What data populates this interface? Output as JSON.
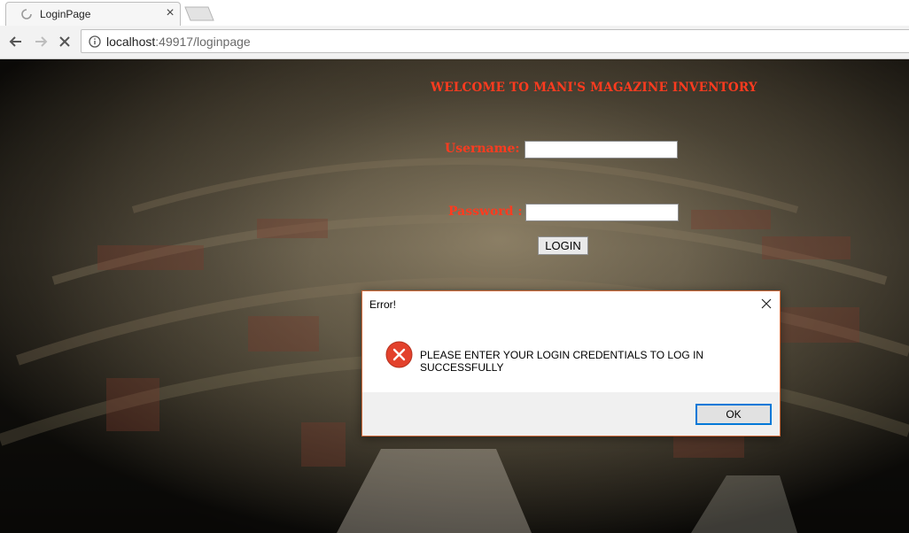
{
  "browser": {
    "tab_title": "LoginPage",
    "tab_close": "×",
    "url_host": "localhost",
    "url_rest": ":49917/loginpage"
  },
  "page": {
    "welcome": "WELCOME TO MANI'S MAGAZINE INVENTORY",
    "username_label": "Username:",
    "password_label": "Password :",
    "username_value": "",
    "password_value": "",
    "login_button": "LOGIN"
  },
  "dialog": {
    "title": "Error!",
    "icon": "error-icon",
    "message": "PLEASE ENTER YOUR LOGIN CREDENTIALS TO LOG IN SUCCESSFULLY",
    "ok_button": "OK"
  },
  "colors": {
    "label_accent": "#ff3b1f",
    "error_red": "#e3412c",
    "focus_blue": "#0078d7"
  }
}
